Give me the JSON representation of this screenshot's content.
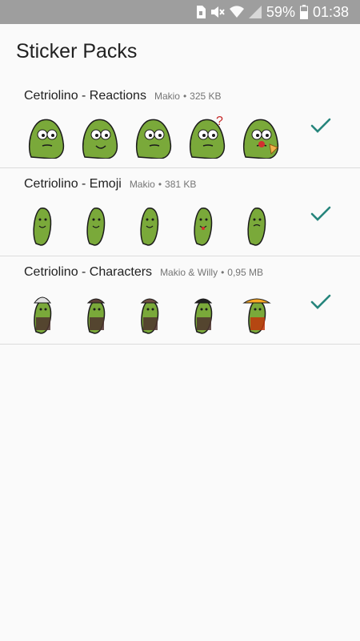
{
  "status_bar": {
    "battery_percent": "59%",
    "time": "01:38",
    "icons": [
      "sim-icon",
      "mute-icon",
      "wifi-icon",
      "signal-icon",
      "battery-icon"
    ]
  },
  "title": "Sticker Packs",
  "colors": {
    "accent": "#26857c",
    "pickle_green": "#7aa93a",
    "status_bar": "#9e9e9e"
  },
  "packs": [
    {
      "name": "Cetriolino - Reactions",
      "author": "Makio",
      "size": "325 KB",
      "selected": true,
      "stickers": [
        "pickle-glasses-sticker",
        "pickle-laughing-sticker",
        "pickle-annoyed-sticker",
        "pickle-question-sticker",
        "pickle-pizza-sticker"
      ]
    },
    {
      "name": "Cetriolino - Emoji",
      "author": "Makio",
      "size": "381 KB",
      "selected": true,
      "stickers": [
        "pickle-neutral-emoji-sticker",
        "pickle-smile-emoji-sticker",
        "pickle-happy-emoji-sticker",
        "pickle-tongue-emoji-sticker",
        "pickle-sad-emoji-sticker"
      ]
    },
    {
      "name": "Cetriolino - Characters",
      "author": "Makio & Willy",
      "size": "0,95 MB",
      "selected": true,
      "stickers": [
        "pickle-einstein-sticker",
        "pickle-viking-sticker",
        "pickle-cowboy-sticker",
        "pickle-pirate-sticker",
        "pickle-mexican-sticker"
      ]
    }
  ]
}
